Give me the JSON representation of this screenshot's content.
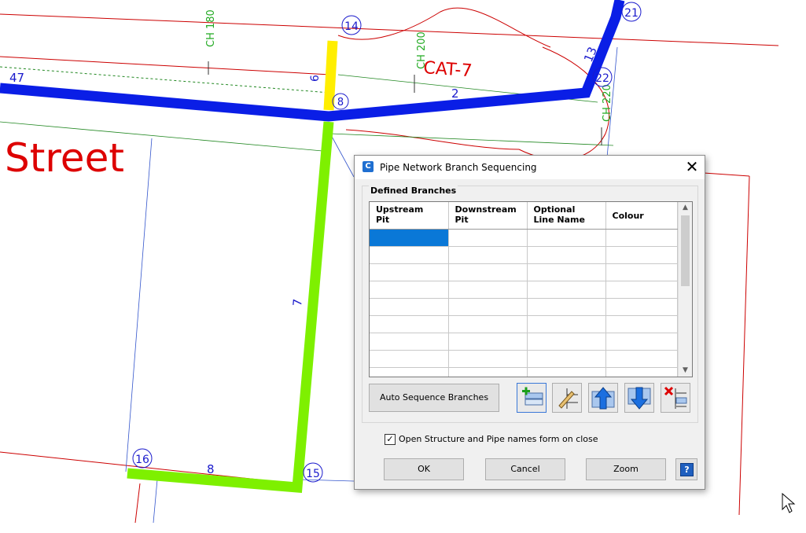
{
  "drawing": {
    "street_label": "Street",
    "catchment_label": "CAT-7",
    "chainage_labels": [
      "CH 180",
      "CH 200",
      "CH 220"
    ],
    "pit_labels": [
      "14",
      "21",
      "22",
      "8",
      "16",
      "15"
    ],
    "pipe_labels": [
      "47",
      "6",
      "2",
      "13",
      "7",
      "8"
    ],
    "colors": {
      "main_pipe": "#0a1ee6",
      "branch_pipe": "#7ef000",
      "short_pipe": "#ffee00",
      "linework": "#cc0000"
    }
  },
  "dialog": {
    "app_icon": "C",
    "title": "Pipe Network Branch Sequencing",
    "close_icon": "✕",
    "group_label": "Defined Branches",
    "columns": [
      {
        "line1": "Upstream",
        "line2": "Pit"
      },
      {
        "line1": "Downstream",
        "line2": "Pit"
      },
      {
        "line1": "Optional",
        "line2": "Line Name"
      },
      {
        "line1": "Colour",
        "line2": ""
      }
    ],
    "row_count": 9,
    "selected_row": 0,
    "auto_sequence_label": "Auto Sequence Branches",
    "tools": [
      "add-branch-icon",
      "edit-branch-icon",
      "move-up-icon",
      "move-down-icon",
      "delete-branch-icon"
    ],
    "checkbox_checked": true,
    "checkbox_mark": "✓",
    "checkbox_label": "Open Structure and Pipe names form on close",
    "ok_label": "OK",
    "cancel_label": "Cancel",
    "zoom_label": "Zoom",
    "help_icon": "?"
  }
}
